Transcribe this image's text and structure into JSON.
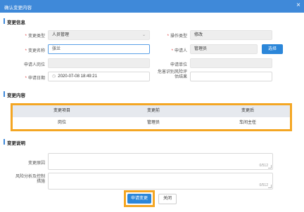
{
  "dialog": {
    "title": "确认变更内容",
    "close_glyph": "×"
  },
  "change_info": {
    "section_title": "变更信息",
    "change_type_label": "变更类型",
    "change_type_value": "人员管理",
    "operation_type_label": "操作类型",
    "operation_type_value": "修改",
    "change_name_label": "变更名称",
    "change_name_value": "张兰",
    "applicant_label": "申请人",
    "applicant_value": "管理员",
    "select_button": "选择",
    "applicant_position_label": "申请人岗位",
    "applicant_position_value": "",
    "applicant_unit_label": "申请单位",
    "applicant_unit_value": "",
    "apply_date_label": "申请日期",
    "apply_date_value": "2020-07-08 18:49:21",
    "risk_result_label_line1": "危害识别风险评",
    "risk_result_label_line2": "估结果",
    "risk_result_value": ""
  },
  "change_content": {
    "section_title": "变更内容",
    "headers": [
      "变更项目",
      "变更前",
      "变更后"
    ],
    "rows": [
      [
        "岗位",
        "管理员",
        "车间主任"
      ]
    ]
  },
  "change_desc": {
    "section_title": "变更说明",
    "reason_label": "变更原因",
    "reason_counter": "0/512",
    "risk_label_line1": "风险分析及控制",
    "risk_label_line2": "措施",
    "risk_counter": "0/512"
  },
  "footer": {
    "apply_button": "申请变更",
    "close_button": "关闭"
  },
  "colors": {
    "accent": "#3f89d9",
    "highlight": "#f4a623"
  }
}
